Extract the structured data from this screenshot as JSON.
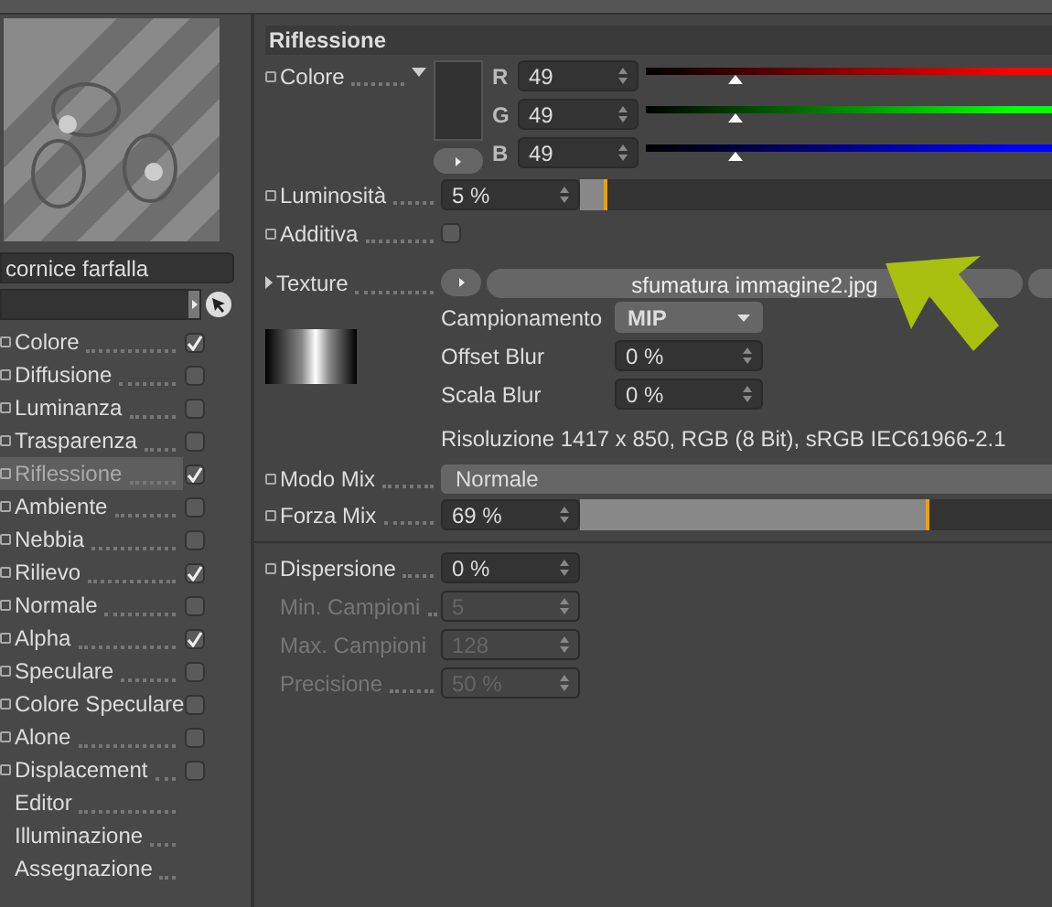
{
  "sidebar": {
    "material_name": "cornice farfalla",
    "channels": [
      {
        "label": "Colore",
        "kind": "check",
        "checked": true,
        "selected": false
      },
      {
        "label": "Diffusione",
        "kind": "check",
        "checked": false,
        "selected": false
      },
      {
        "label": "Luminanza",
        "kind": "check",
        "checked": false,
        "selected": false
      },
      {
        "label": "Trasparenza",
        "kind": "check",
        "checked": false,
        "selected": false
      },
      {
        "label": "Riflessione",
        "kind": "check",
        "checked": true,
        "selected": true
      },
      {
        "label": "Ambiente",
        "kind": "check",
        "checked": false,
        "selected": false
      },
      {
        "label": "Nebbia",
        "kind": "check",
        "checked": false,
        "selected": false
      },
      {
        "label": "Rilievo",
        "kind": "check",
        "checked": true,
        "selected": false
      },
      {
        "label": "Normale",
        "kind": "check",
        "checked": false,
        "selected": false
      },
      {
        "label": "Alpha",
        "kind": "check",
        "checked": true,
        "selected": false
      },
      {
        "label": "Speculare",
        "kind": "check",
        "checked": false,
        "selected": false
      },
      {
        "label": "Colore Speculare",
        "kind": "check",
        "checked": false,
        "selected": false
      },
      {
        "label": "Alone",
        "kind": "check",
        "checked": false,
        "selected": false
      },
      {
        "label": "Displacement",
        "kind": "check",
        "checked": false,
        "selected": false
      },
      {
        "label": "Editor",
        "kind": "plain",
        "selected": false
      },
      {
        "label": "Illuminazione",
        "kind": "plain",
        "selected": false
      },
      {
        "label": "Assegnazione",
        "kind": "plain",
        "selected": false
      }
    ]
  },
  "panel": {
    "title": "Riflessione",
    "color": {
      "label": "Colore",
      "channels": [
        {
          "name": "R",
          "value": "49",
          "level": 0.22,
          "color": "#ff0000"
        },
        {
          "name": "G",
          "value": "49",
          "level": 0.22,
          "color": "#00ff00"
        },
        {
          "name": "B",
          "value": "49",
          "level": 0.22,
          "color": "#0000ff"
        }
      ]
    },
    "brightness": {
      "label": "Luminosità",
      "value": "5 %",
      "level": 0.06
    },
    "additive": {
      "label": "Additiva",
      "checked": false
    },
    "texture": {
      "label": "Texture",
      "file": "sfumatura immagine2.jpg",
      "fields": [
        {
          "label": "Campionamento",
          "value": "MIP",
          "kind": "dropdown"
        },
        {
          "label": "Offset Blur",
          "value": "0 %",
          "kind": "spin"
        },
        {
          "label": "Scala Blur",
          "value": "0 %",
          "kind": "spin"
        }
      ],
      "info": "Risoluzione 1417 x 850, RGB (8 Bit), sRGB IEC61966-2.1"
    },
    "mix_mode": {
      "label": "Modo Mix",
      "value": "Normale"
    },
    "mix_strength": {
      "label": "Forza Mix",
      "value": "69 %",
      "level": 0.74
    },
    "dispersion": [
      {
        "label": "Dispersione",
        "value": "0 %",
        "disabled": false
      },
      {
        "label": "Min. Campioni",
        "value": "5",
        "disabled": true
      },
      {
        "label": "Max. Campioni",
        "value": "128",
        "disabled": true
      },
      {
        "label": "Precisione",
        "value": "50 %",
        "disabled": true
      }
    ]
  }
}
